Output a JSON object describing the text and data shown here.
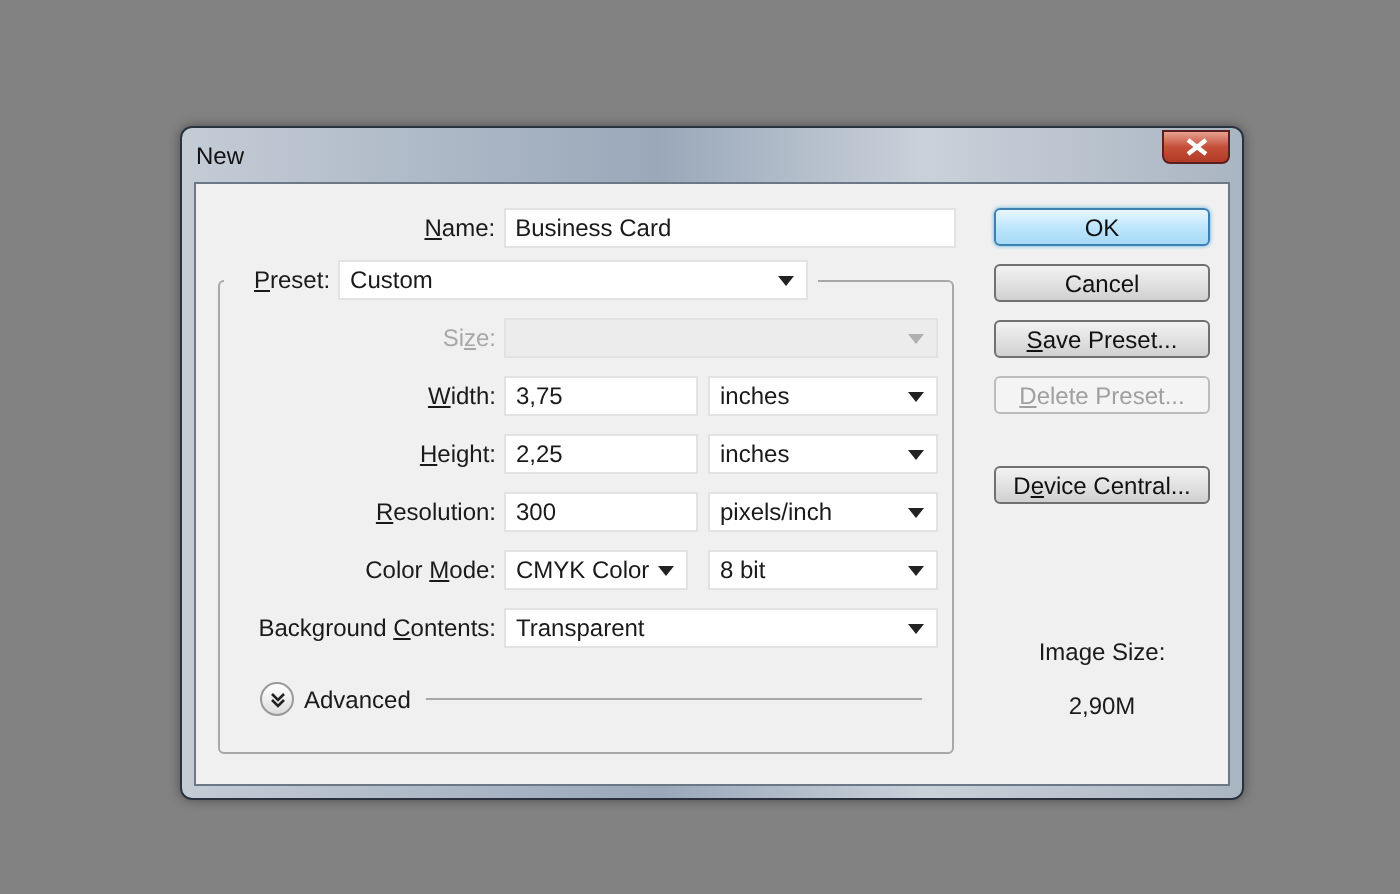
{
  "window": {
    "title": "New"
  },
  "name": {
    "label": [
      {
        "text": "N",
        "underline": true
      },
      {
        "text": "ame:",
        "underline": false
      }
    ],
    "value": "Business Card"
  },
  "preset": {
    "label": [
      {
        "text": "P",
        "underline": true
      },
      {
        "text": "reset:",
        "underline": false
      }
    ],
    "value": "Custom"
  },
  "fields": [
    {
      "kind": "select",
      "disabled": true,
      "label": [
        {
          "text": "Si",
          "underline": false
        },
        {
          "text": "z",
          "underline": true
        },
        {
          "text": "e:",
          "underline": false
        }
      ]
    },
    {
      "kind": "number-unit",
      "disabled": false,
      "label": [
        {
          "text": "W",
          "underline": true
        },
        {
          "text": "idth:",
          "underline": false
        }
      ],
      "value": "3,75",
      "unit": "inches"
    },
    {
      "kind": "number-unit",
      "disabled": false,
      "label": [
        {
          "text": "H",
          "underline": true
        },
        {
          "text": "eight:",
          "underline": false
        }
      ],
      "value": "2,25",
      "unit": "inches"
    },
    {
      "kind": "number-unit",
      "disabled": false,
      "label": [
        {
          "text": "R",
          "underline": true
        },
        {
          "text": "esolution:",
          "underline": false
        }
      ],
      "value": "300",
      "unit": "pixels/inch"
    },
    {
      "kind": "select-pair",
      "disabled": false,
      "label": [
        {
          "text": "Color ",
          "underline": false
        },
        {
          "text": "M",
          "underline": true
        },
        {
          "text": "ode:",
          "underline": false
        }
      ],
      "value": "CMYK Color",
      "unit": "8 bit"
    },
    {
      "kind": "select",
      "disabled": false,
      "label": [
        {
          "text": "Background ",
          "underline": false
        },
        {
          "text": "C",
          "underline": true
        },
        {
          "text": "ontents:",
          "underline": false
        }
      ],
      "value": "Transparent"
    }
  ],
  "advanced": {
    "label": "Advanced",
    "expanded": false
  },
  "buttons": [
    {
      "label": [
        {
          "text": "OK",
          "underline": false
        }
      ],
      "default": true,
      "disabled": false
    },
    {
      "label": [
        {
          "text": "Cancel",
          "underline": false
        }
      ],
      "default": false,
      "disabled": false
    },
    {
      "label": [
        {
          "text": "S",
          "underline": true
        },
        {
          "text": "ave Preset...",
          "underline": false
        }
      ],
      "default": false,
      "disabled": false
    },
    {
      "label": [
        {
          "text": "D",
          "underline": true
        },
        {
          "text": "elete Preset...",
          "underline": false
        }
      ],
      "default": false,
      "disabled": true
    },
    {
      "label": [
        {
          "text": "D",
          "underline": false
        },
        {
          "text": "e",
          "underline": true
        },
        {
          "text": "vice Central...",
          "underline": false
        }
      ],
      "default": false,
      "disabled": false
    }
  ],
  "image_size": {
    "label": "Image Size:",
    "value": "2,90M"
  }
}
